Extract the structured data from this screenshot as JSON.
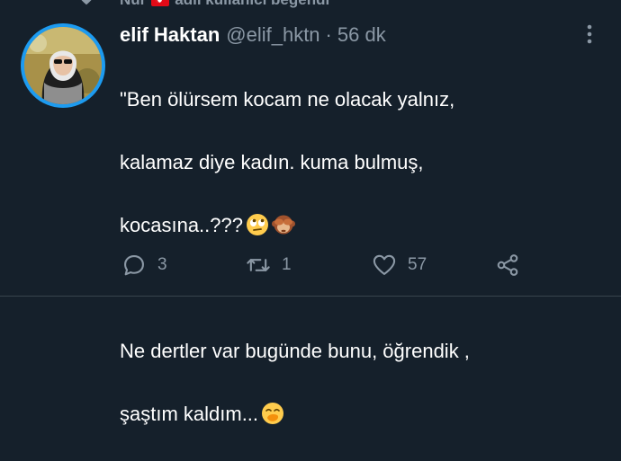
{
  "context": {
    "user": "Nur",
    "text": "adlı kullanıcı beğendi"
  },
  "tweet": {
    "display_name": "elif Haktan",
    "handle": "@elif_hktn",
    "separator": "·",
    "time": "56 dk",
    "line1": "\"Ben ölürsem kocam ne olacak yalnız,",
    "line2": "kalamaz diye kadın. kuma bulmuş,",
    "line3": "kocasına..???",
    "line4": "Ne dertler var bugünde bunu, öğrendik ,",
    "line5": "şaştım kaldım..."
  },
  "actions": {
    "reply_count": "3",
    "retweet_count": "1",
    "like_count": "57"
  },
  "icons": {
    "context": "heart-icon",
    "more": "more-vertical-icon",
    "reply": "reply-icon",
    "retweet": "retweet-icon",
    "like": "heart-icon",
    "share": "share-icon",
    "emoji1": "eye-roll-emoji",
    "emoji2": "see-no-evil-monkey-emoji",
    "emoji3": "hand-over-mouth-emoji"
  },
  "colors": {
    "background": "#15202b",
    "secondary_text": "#8b98a5",
    "avatar_ring": "#1d9bf0",
    "divider": "#38444d"
  }
}
